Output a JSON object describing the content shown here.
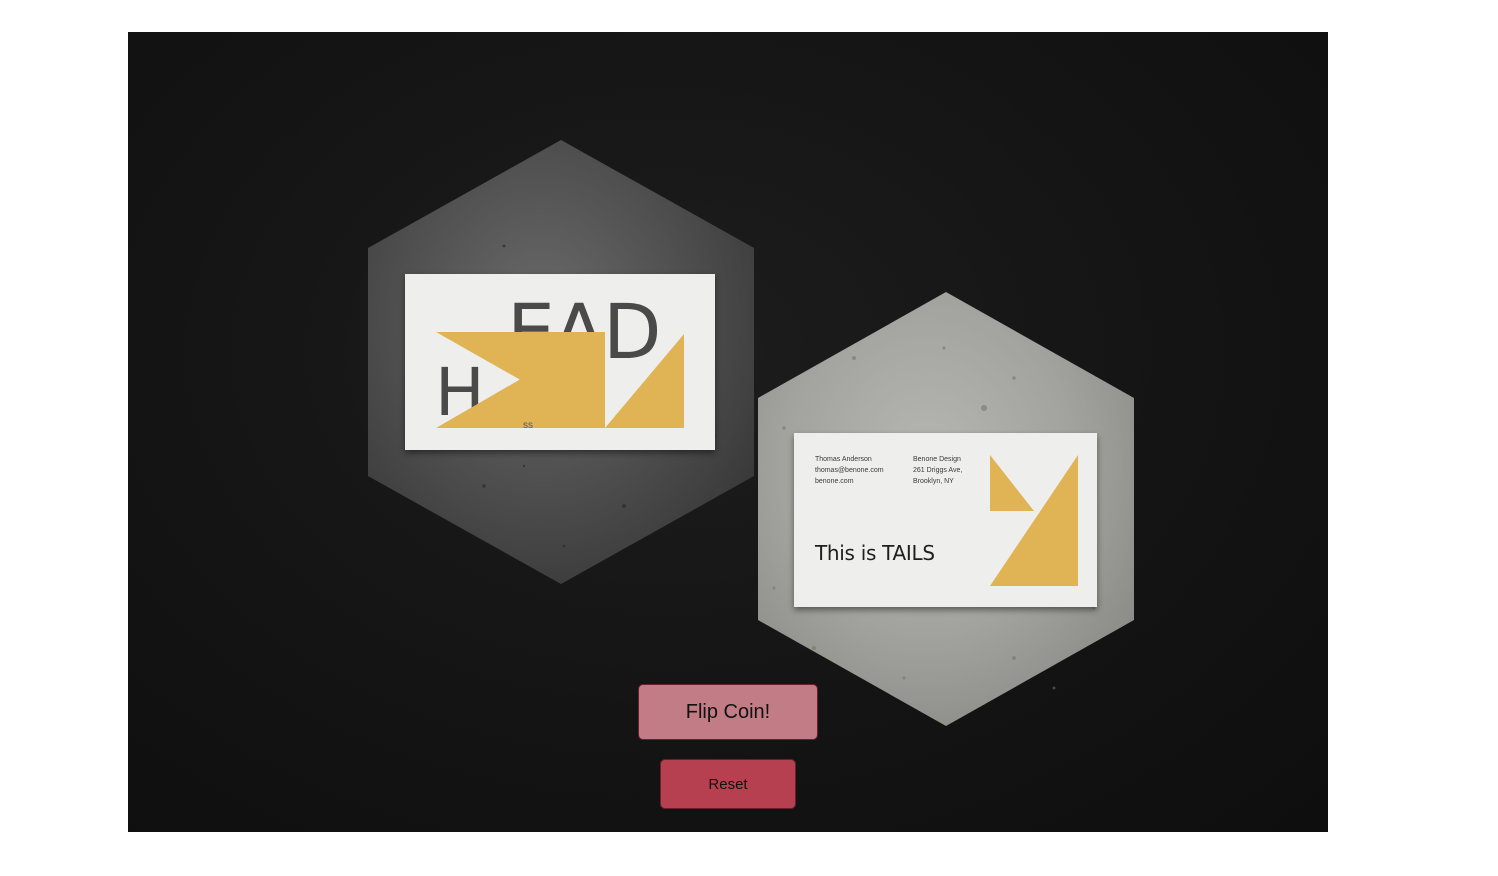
{
  "heads_card": {
    "letter_h": "H",
    "letters_ead": "EAD",
    "small_text": "ss"
  },
  "tails_card": {
    "name": "Thomas Anderson",
    "email": "thomas@benone.com",
    "website": "benone.com",
    "company": "Benone Design",
    "address_line1": "261 Driggs Ave,",
    "address_line2": "Brooklyn, NY",
    "title": "This is TAILS"
  },
  "buttons": {
    "flip_label": "Flip Coin!",
    "reset_label": "Reset"
  },
  "colors": {
    "accent_yellow": "#e0b355",
    "flip_button": "#c17c86",
    "reset_button": "#b6404f",
    "background_dark": "#141414"
  },
  "icons": [
    "coaster-hex-dark",
    "coaster-hex-light"
  ]
}
